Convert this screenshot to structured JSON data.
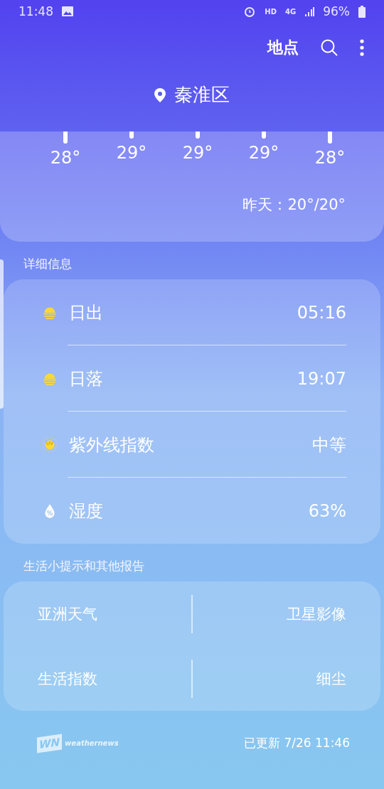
{
  "status_bar": {
    "time": "11:48",
    "hd": "HD",
    "network": "4G",
    "battery": "96%"
  },
  "toolbar": {
    "locations": "地点"
  },
  "location": "秦淮区",
  "hourly": [
    {
      "temp": "28°"
    },
    {
      "temp": "29°"
    },
    {
      "temp": "29°"
    },
    {
      "temp": "29°"
    },
    {
      "temp": "28°"
    }
  ],
  "yesterday": "昨天：20°/20°",
  "details": {
    "title": "详细信息",
    "rows": [
      {
        "kind": "sunrise",
        "label": "日出",
        "value": "05:16"
      },
      {
        "kind": "sunset",
        "label": "日落",
        "value": "19:07"
      },
      {
        "kind": "uv",
        "label": "紫外线指数",
        "value": "中等",
        "badge": "UV"
      },
      {
        "kind": "humidity",
        "label": "湿度",
        "value": "63%",
        "badge": "%"
      }
    ]
  },
  "reports": {
    "title": "生活小提示和其他报告",
    "links": [
      [
        "亚洲天气",
        "卫星影像"
      ],
      [
        "生活指数",
        "细尘"
      ]
    ]
  },
  "footer": {
    "logo_mark": "WN",
    "logo_text": "weathernews",
    "updated": "已更新 7/26 11:46"
  }
}
